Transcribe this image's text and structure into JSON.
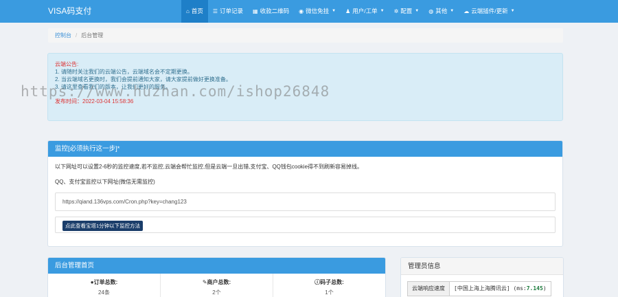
{
  "brand": "VISA码支付",
  "nav": [
    {
      "label": "首页",
      "icon": "home-icon",
      "glyph": "⌂",
      "active": true,
      "caret": false
    },
    {
      "label": "订单记录",
      "icon": "list-icon",
      "glyph": "☰",
      "active": false,
      "caret": false
    },
    {
      "label": "收款二维码",
      "icon": "qrcode-icon",
      "glyph": "▦",
      "active": false,
      "caret": false
    },
    {
      "label": "微信免挂",
      "icon": "wechat-icon",
      "glyph": "◉",
      "active": false,
      "caret": true
    },
    {
      "label": "用户/工单",
      "icon": "user-icon",
      "glyph": "♟",
      "active": false,
      "caret": true
    },
    {
      "label": "配置",
      "icon": "gear-icon",
      "glyph": "✲",
      "active": false,
      "caret": true
    },
    {
      "label": "其他",
      "icon": "globe-icon",
      "glyph": "◍",
      "active": false,
      "caret": true
    },
    {
      "label": "云端插件/更新",
      "icon": "cloud-icon",
      "glyph": "☁",
      "active": false,
      "caret": true
    }
  ],
  "breadcrumb": {
    "home": "控制台",
    "sep": "/",
    "current": "后台管理"
  },
  "notice": {
    "title": "云端公告:",
    "line1": "1. 请随时关注我们的云端公告，云端域名会不定期更换。",
    "line2": "2. 当云端域名更换时，我们会提前通知大家，请大家提前做好更换准备。",
    "line3": "3. 请这里查看我们的版本，让我们更好的服务。",
    "published": "发布时间：2022-03-04 15:58:36"
  },
  "watermark": "https://www.huzhan.com/ishop26848",
  "monitor": {
    "title": "监控[必须执行这一步]*",
    "desc": "以下网址可以设置2-6秒的监控速度,若不监控,云端会帮忙监控,但是云端一旦出错,支付宝、QQ钱包cookie得不到刷新容易掉线。",
    "desc2": "QQ、支付宝监控以下网址(微信无需监控)",
    "url": "https://qiand.136vps.com/Cron.php?key=chang123",
    "button": "点此查看宝塔1分钟以下监控方法"
  },
  "admin_home": {
    "title": "后台管理首页",
    "stats": [
      {
        "label": "订单总数:",
        "icon": "drop-icon",
        "glyph": "●",
        "value": "24条"
      },
      {
        "label": "商户总数:",
        "icon": "edit-icon",
        "glyph": "✎",
        "value": "2个"
      },
      {
        "label": "码子总数:",
        "icon": "info-icon",
        "glyph": "ⓘ",
        "value": "1个"
      }
    ]
  },
  "admin_info": {
    "title": "管理员信息",
    "speed_label": "云端响应速度",
    "speed_value": "[中国上海上海腾讯云]",
    "speed_ms_prefix": "(ms:",
    "speed_ms": "7.145",
    "speed_ms_suffix": ")"
  }
}
